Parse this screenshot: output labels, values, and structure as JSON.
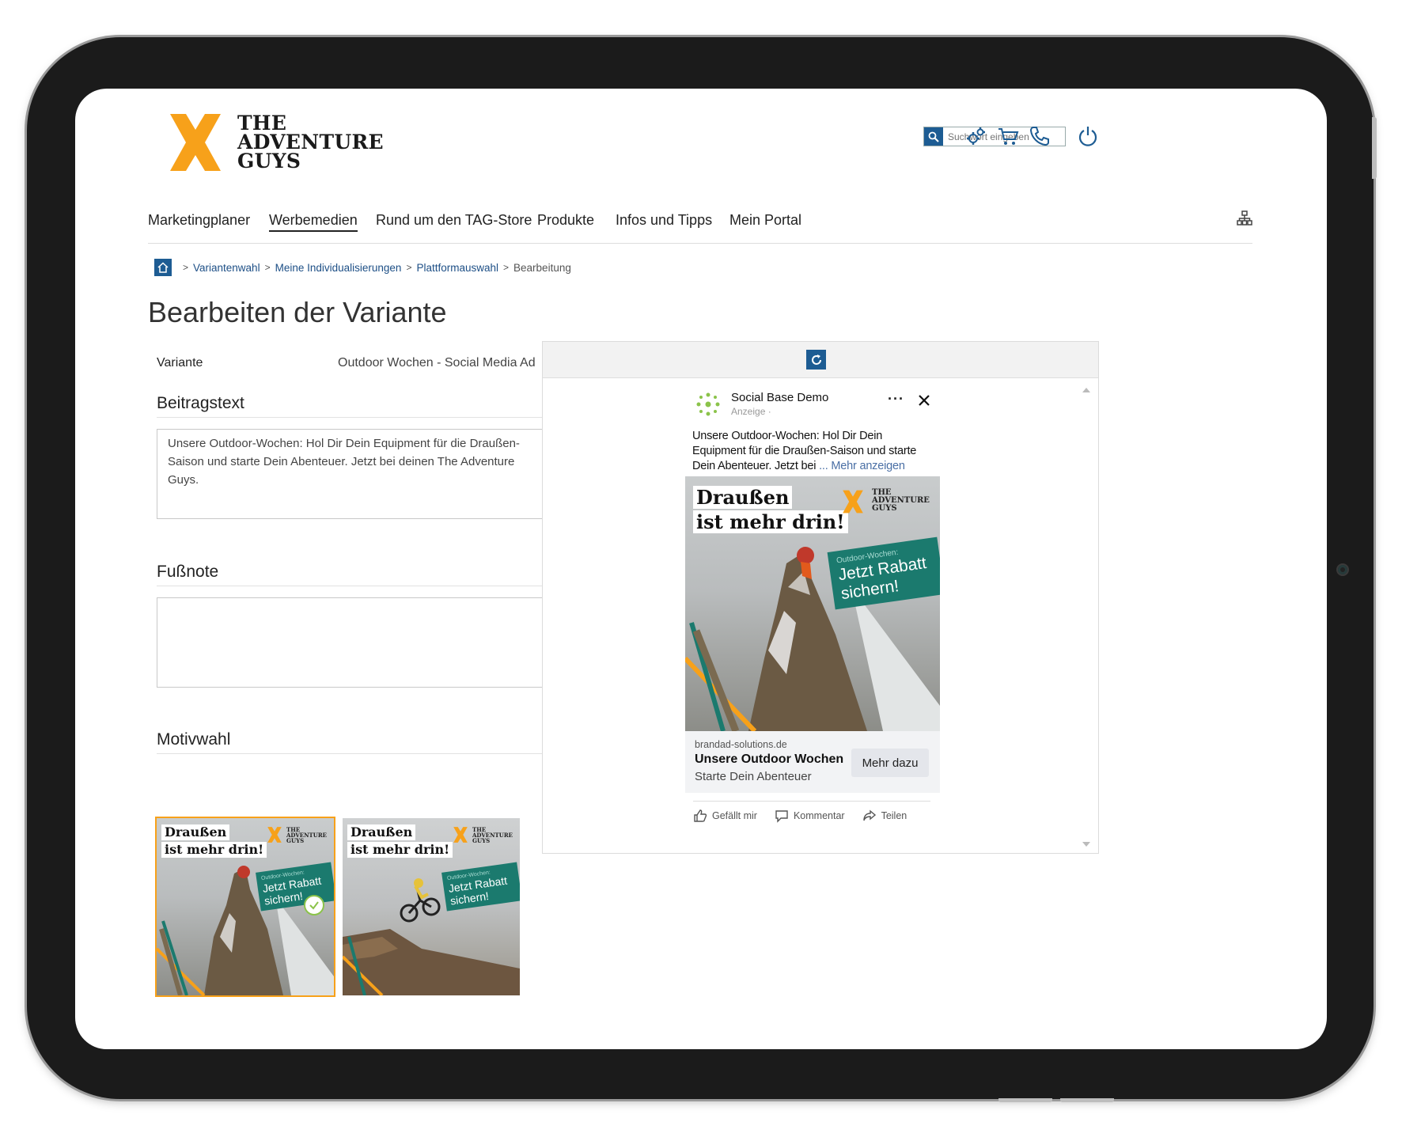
{
  "brand": {
    "logo_lines": [
      "THE",
      "ADVENTURE",
      "GUYS"
    ],
    "accent": "#f7a11a",
    "primary": "#1d5c93"
  },
  "header": {
    "search_placeholder": "Suchwort eingeben",
    "icons": [
      "gears-icon",
      "cart-icon",
      "phone-icon",
      "power-icon"
    ]
  },
  "nav": {
    "items": [
      "Marketingplaner",
      "Werbemedien",
      "Rund um den TAG-Store",
      "Produkte",
      "Infos und Tipps",
      "Mein Portal"
    ],
    "active": "Werbemedien"
  },
  "breadcrumb": {
    "items": [
      "Variantenwahl",
      "Meine Individualisierungen",
      "Plattformauswahl"
    ],
    "current": "Bearbeitung"
  },
  "page": {
    "title": "Bearbeiten der Variante",
    "variant_label": "Variante",
    "variant_value": "Outdoor Wochen - Social Media Ad"
  },
  "form": {
    "post_text_heading": "Beitragstext",
    "post_text_value": "Unsere Outdoor-Wochen: Hol Dir Dein Equipment für die Draußen-Saison und starte Dein Abenteuer. Jetzt bei deinen The Adventure Guys.",
    "footnote_heading": "Fußnote",
    "footnote_value": "",
    "motif_heading": "Motivwahl"
  },
  "motifs": [
    {
      "line1": "Draußen",
      "line2": "ist mehr drin!",
      "badge_small": "Outdoor-Wochen:",
      "badge_line1": "Jetzt Rabatt",
      "badge_line2": "sichern!",
      "selected": true
    },
    {
      "line1": "Draußen",
      "line2": "ist mehr drin!",
      "badge_small": "Outdoor-Wochen:",
      "badge_line1": "Jetzt Rabatt",
      "badge_line2": "sichern!",
      "selected": false
    }
  ],
  "preview": {
    "page_name": "Social Base Demo",
    "sponsored": "Anzeige ·",
    "post_text": "Unsere Outdoor-Wochen: Hol Dir Dein Equipment für die Draußen-Saison und starte Dein Abenteuer. Jetzt bei",
    "more_link": "... Mehr anzeigen",
    "ad": {
      "line1": "Draußen",
      "line2": "ist mehr drin!",
      "badge_small": "Outdoor-Wochen:",
      "badge_line1": "Jetzt Rabatt",
      "badge_line2": "sichern!"
    },
    "domain": "brandad-solutions.de",
    "headline": "Unsere Outdoor Wochen",
    "description": "Starte Dein Abenteuer",
    "cta": "Mehr dazu",
    "actions": [
      "Gefällt mir",
      "Kommentar",
      "Teilen"
    ]
  }
}
